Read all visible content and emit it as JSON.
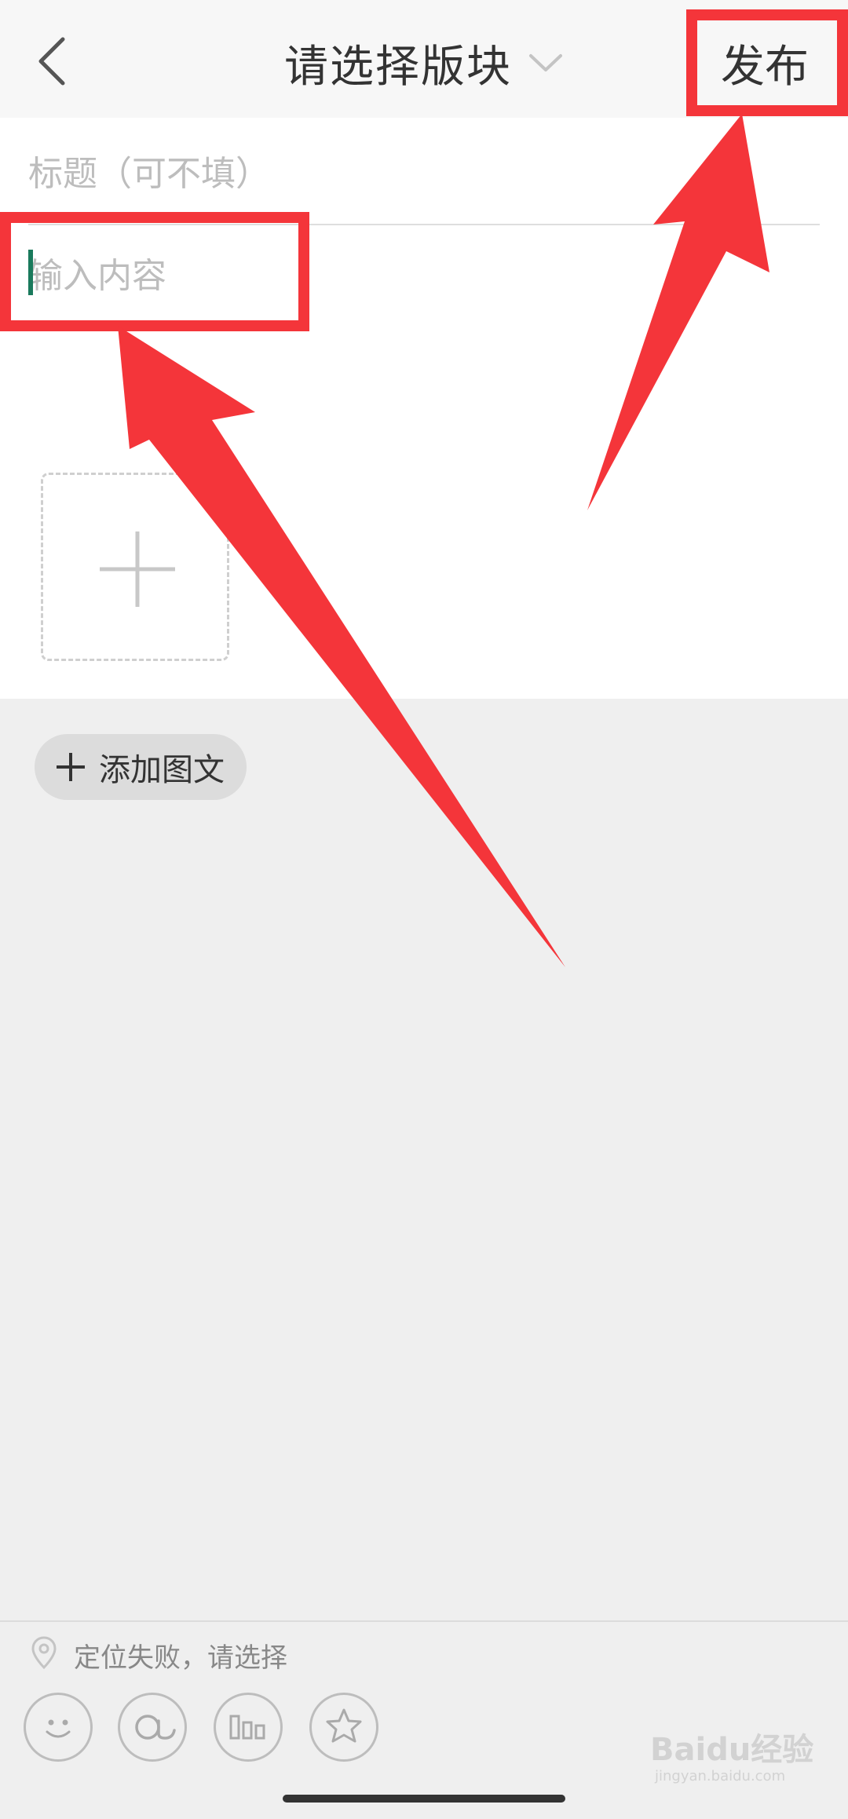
{
  "header": {
    "back_icon": "chevron-left-icon",
    "title": "请选择版块",
    "dropdown_icon": "chevron-down-icon",
    "publish_label": "发布"
  },
  "editor": {
    "title_placeholder": "标题（可不填）",
    "content_placeholder": "输入内容",
    "add_image_icon": "plus-icon",
    "add_article_label": "添加图文"
  },
  "footer": {
    "location_icon": "map-pin-icon",
    "location_text": "定位失败，请选择",
    "tools": [
      "emoji-icon",
      "mention-icon",
      "poll-icon",
      "sticker-icon"
    ]
  },
  "watermark": {
    "text": "Baidu经验",
    "sub": "jingyan.baidu.com"
  },
  "annotation": {
    "color": "#f4353a"
  }
}
